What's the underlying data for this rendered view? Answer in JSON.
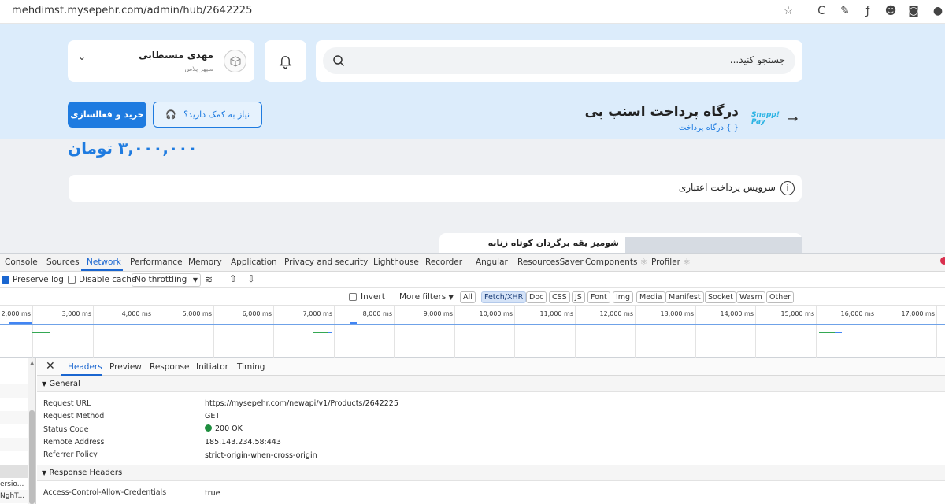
{
  "browser": {
    "url": "mehdimst.mysepehr.com/admin/hub/2642225"
  },
  "header": {
    "search_placeholder": "جستجو کنید...",
    "user": {
      "name": "مهدی مستطابی",
      "subtitle": "سپهر پلاس"
    }
  },
  "product": {
    "buy_label": "خرید و فعالسازی",
    "help_label": "نیاز به کمک دارید؟",
    "title": "درگاه پرداخت اسنپ پی",
    "category": "{ } درگاه پرداخت",
    "brand_logo_text": "Snapp! Pay",
    "price": "۳,۰۰۰,۰۰۰ تومان",
    "service_text": "سرویس پرداخت اعتباری",
    "info_glyph": "i",
    "card_title": "شومیز یقه برگردان کوتاه زنانه"
  },
  "devtools": {
    "tabs": [
      "Console",
      "Sources",
      "Network",
      "Performance",
      "Memory",
      "Application",
      "Privacy and security",
      "Lighthouse",
      "Recorder",
      "Angular",
      "ResourcesSaver",
      "Components",
      "Profiler"
    ],
    "active_tab": "Network",
    "toolbar": {
      "preserve_log": "Preserve log",
      "preserve_log_checked": true,
      "disable_cache": "Disable cache",
      "disable_cache_checked": false,
      "throttling": "No throttling"
    },
    "filters": {
      "invert": "Invert",
      "more_filters": "More filters",
      "types": [
        "All",
        "Fetch/XHR",
        "Doc",
        "CSS",
        "JS",
        "Font",
        "Img",
        "Media",
        "Manifest",
        "Socket",
        "Wasm",
        "Other"
      ],
      "active_type": "Fetch/XHR"
    },
    "timeline_ticks": [
      "2,000 ms",
      "3,000 ms",
      "4,000 ms",
      "5,000 ms",
      "6,000 ms",
      "7,000 ms",
      "8,000 ms",
      "9,000 ms",
      "10,000 ms",
      "11,000 ms",
      "12,000 ms",
      "13,000 ms",
      "14,000 ms",
      "15,000 ms",
      "16,000 ms",
      "17,000 ms"
    ],
    "left_rows": [
      "ersio...",
      "NghT..."
    ],
    "detail": {
      "tabs": [
        "Headers",
        "Preview",
        "Response",
        "Initiator",
        "Timing"
      ],
      "active_tab": "Headers",
      "general_title": "General",
      "general": [
        {
          "key": "Request URL",
          "value": "https://mysepehr.com/newapi/v1/Products/2642225"
        },
        {
          "key": "Request Method",
          "value": "GET"
        },
        {
          "key": "Status Code",
          "value": "200 OK"
        },
        {
          "key": "Remote Address",
          "value": "185.143.234.58:443"
        },
        {
          "key": "Referrer Policy",
          "value": "strict-origin-when-cross-origin"
        }
      ],
      "response_headers_title": "Response Headers",
      "response_headers": [
        {
          "key": "Access-Control-Allow-Credentials",
          "value": "true"
        }
      ]
    }
  },
  "colors": {
    "accent": "#1e7be0",
    "status_ok": "#1e8e3e",
    "devtools_blue": "#1a66d0"
  }
}
